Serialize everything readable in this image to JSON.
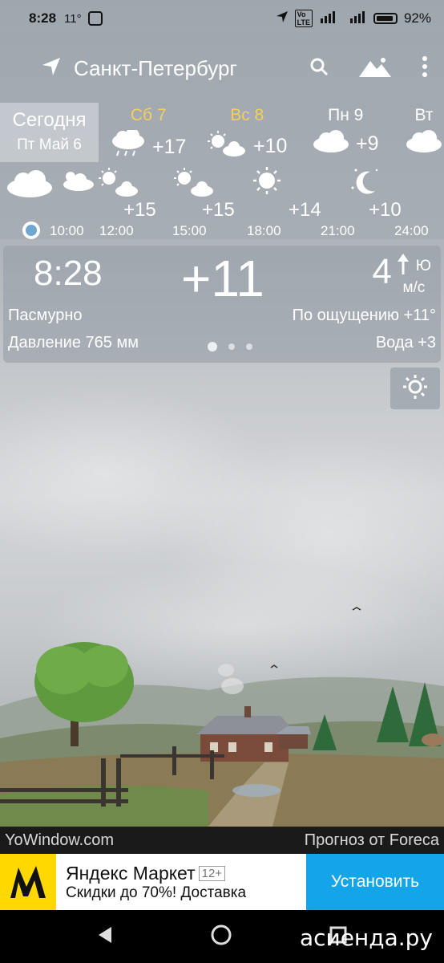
{
  "status": {
    "time": "8:28",
    "temp": "11°",
    "battery": "92%"
  },
  "header": {
    "city": "Санкт-Петербург"
  },
  "forecast": {
    "today_label": "Сегодня",
    "today_date": "Пт Май 6",
    "days": [
      {
        "name": "Сб 7",
        "temp": "+17",
        "weekend": true,
        "icon": "rain-cloud-icon"
      },
      {
        "name": "Вс 8",
        "temp": "+10",
        "weekend": true,
        "icon": "sun-cloud-icon"
      },
      {
        "name": "Пн 9",
        "temp": "+9",
        "weekend": false,
        "icon": "cloud-icon"
      },
      {
        "name": "Вт",
        "temp": "",
        "weekend": false,
        "icon": "cloud-icon"
      }
    ],
    "hourly": {
      "temps": [
        "+15",
        "+15",
        "+14",
        "+10"
      ],
      "times": [
        "10:00",
        "12:00",
        "15:00",
        "18:00",
        "21:00",
        "24:00"
      ]
    }
  },
  "current": {
    "time": "8:28",
    "temp": "+11",
    "wind_speed": "4",
    "wind_dir": "Ю",
    "wind_unit": "м/с",
    "condition": "Пасмурно",
    "pressure": "Давление 765 мм",
    "feels_like": "По ощущению +11°",
    "water": "Вода +3"
  },
  "footer": {
    "left": "YoWindow.com",
    "right": "Прогноз от Foreca"
  },
  "ad": {
    "title": "Яндекс Маркет",
    "badge": "12+",
    "subtitle": "Скидки до 70%! Доставка",
    "button": "Установить"
  },
  "watermark": "асиенда.ру"
}
